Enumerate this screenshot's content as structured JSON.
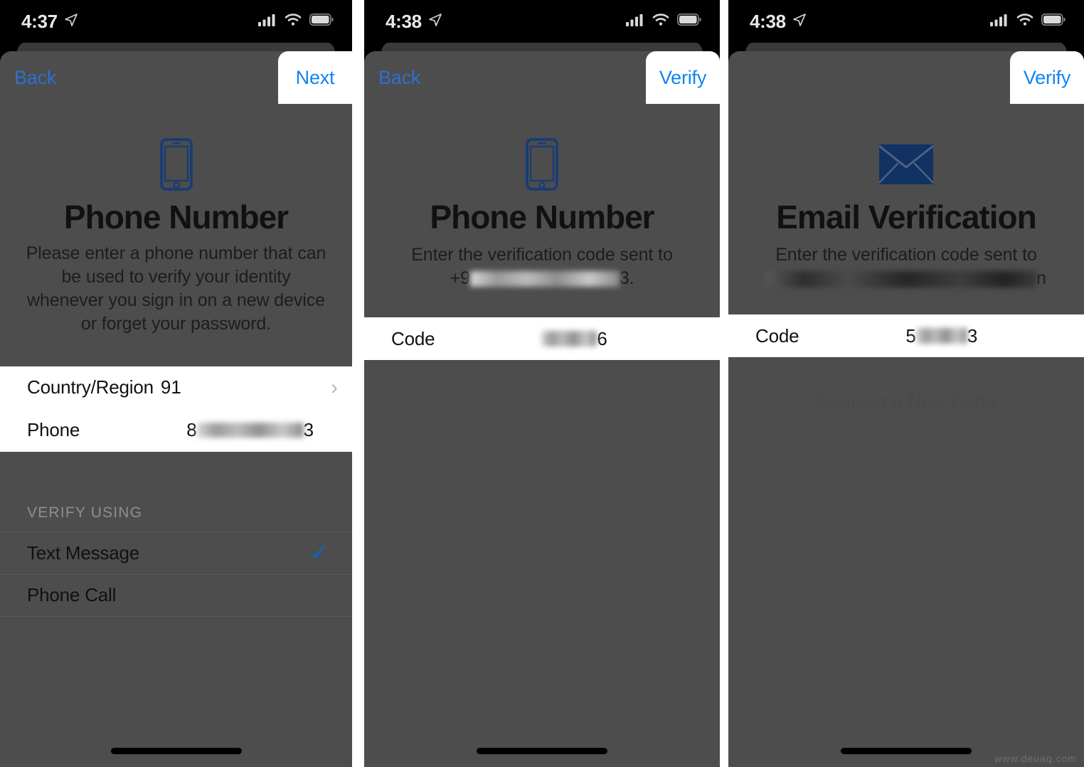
{
  "panels": [
    {
      "status": {
        "time": "4:37",
        "location_icon": "location-arrow-icon",
        "signal_icon": "cellular-signal-icon",
        "wifi_icon": "wifi-icon",
        "battery_icon": "battery-icon"
      },
      "nav": {
        "back_label": "Back",
        "action_label": "Next"
      },
      "hero": {
        "icon": "smartphone-icon",
        "title": "Phone Number",
        "subtitle": "Please enter a phone number that can be used to verify your identity whenever you sign in on a new device or forget your password."
      },
      "form": {
        "country_label": "Country/Region",
        "country_value": "91",
        "chevron_icon": "chevron-right-icon",
        "phone_label": "Phone",
        "phone_value_prefix": "8",
        "phone_value_suffix": "3"
      },
      "verify_using": {
        "header": "VERIFY USING",
        "options": [
          {
            "label": "Text Message",
            "selected": true,
            "check_icon": "checkmark-icon"
          },
          {
            "label": "Phone Call",
            "selected": false
          }
        ]
      }
    },
    {
      "status": {
        "time": "4:38"
      },
      "nav": {
        "back_label": "Back",
        "action_label": "Verify"
      },
      "hero": {
        "icon": "smartphone-icon",
        "title": "Phone Number",
        "subtitle_line1": "Enter the verification code sent to",
        "subtitle_prefix": "+9",
        "subtitle_suffix": "3."
      },
      "form": {
        "code_label": "Code",
        "code_value_suffix": "6"
      }
    },
    {
      "status": {
        "time": "4:38"
      },
      "nav": {
        "back_label": "",
        "action_label": "Verify"
      },
      "hero": {
        "icon": "envelope-icon",
        "title": "Email Verification",
        "subtitle_line1": "Enter the verification code sent to",
        "subtitle_suffix": "n"
      },
      "form": {
        "code_label": "Code",
        "code_value_prefix": "5",
        "code_value_suffix": "3"
      },
      "request_new_code": "Request a New Code"
    }
  ],
  "watermark": "www.deuaq.com",
  "colors": {
    "accent_blue": "#1184f0",
    "nav_back_blue": "#2f6fd0",
    "icon_blue": "#1a3d72",
    "check_blue": "#1a5fb4",
    "dim_overlay": "#4d4d4d",
    "status_bg": "#000000"
  }
}
